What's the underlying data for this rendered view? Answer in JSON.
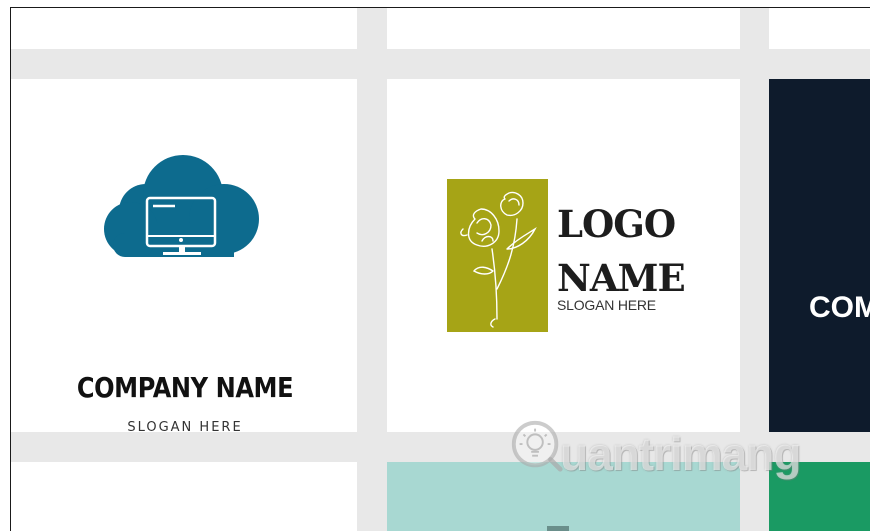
{
  "templates": [
    {
      "id": "company-cloud",
      "title": "COMPANY NAME",
      "slogan": "SLOGAN HERE",
      "icon": "cloud-monitor-icon",
      "icon_color": "#0d6b8e"
    },
    {
      "id": "flower-logo",
      "title_line1": "LOGO",
      "title_line2": "NAME",
      "slogan": "SLOGAN HERE",
      "icon": "peony-flower-icon",
      "accent_color": "#a6a416"
    },
    {
      "id": "dark-company",
      "title_partial": "COM",
      "background_color": "#0e1b2c"
    }
  ],
  "bottom_card_colors": [
    "#ffffff",
    "#a8d8d2",
    "#1a9a63"
  ],
  "watermark": {
    "text": "uantrimang",
    "icon": "quantrimang-logo-icon"
  }
}
